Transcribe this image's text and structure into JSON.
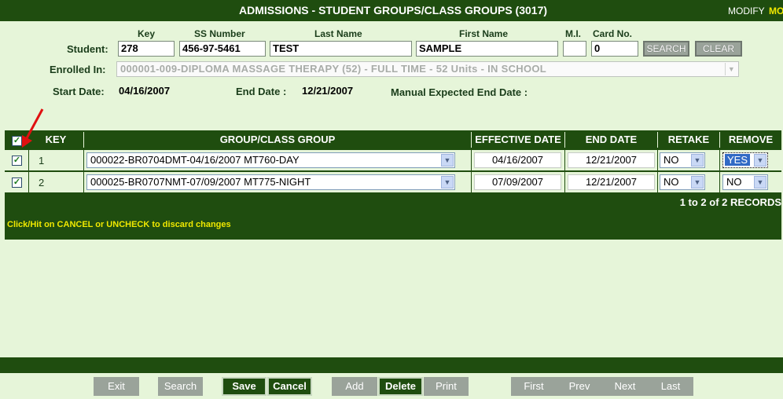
{
  "header": {
    "title": "ADMISSIONS - STUDENT GROUPS/CLASS GROUPS (3017)",
    "mode": "MODIFY",
    "mode_short": "MO"
  },
  "student": {
    "label": "Student:",
    "key_header": "Key",
    "ssn_header": "SS Number",
    "last_header": "Last Name",
    "first_header": "First Name",
    "mi_header": "M.I.",
    "card_header": "Card No.",
    "key": "278",
    "ssn": "456-97-5461",
    "last_name": "TEST",
    "first_name": "SAMPLE",
    "mi": "",
    "card_no": "0",
    "search_label": "SEARCH",
    "clear_label": "CLEAR"
  },
  "enrollment": {
    "label": "Enrolled In:",
    "value": "000001-009-DIPLOMA MASSAGE THERAPY (52) - FULL TIME - 52 Units - IN SCHOOL",
    "start_label": "Start Date:",
    "start_date": "04/16/2007",
    "end_label": "End Date :",
    "end_date": "12/21/2007",
    "manual_label": "Manual Expected End Date :"
  },
  "grid": {
    "columns": {
      "key": "KEY",
      "group": "GROUP/CLASS GROUP",
      "effective": "EFFECTIVE DATE",
      "end": "END DATE",
      "retake": "RETAKE",
      "remove": "REMOVE"
    },
    "rows": [
      {
        "checked": "✓",
        "key": "1",
        "group": "000022-BR0704DMT-04/16/2007 MT760-DAY",
        "effective": "04/16/2007",
        "end": "12/21/2007",
        "retake": "NO",
        "remove": "YES"
      },
      {
        "checked": "✓",
        "key": "2",
        "group": "000025-BR0707NMT-07/09/2007 MT775-NIGHT",
        "effective": "07/09/2007",
        "end": "12/21/2007",
        "retake": "NO",
        "remove": "NO"
      }
    ],
    "header_check": "✓",
    "records": "1 to 2 of 2 RECORDS",
    "hint": "Click/Hit on CANCEL or UNCHECK to discard changes"
  },
  "toolbar": {
    "exit": "Exit",
    "search": "Search",
    "save": "Save",
    "cancel": "Cancel",
    "add": "Add",
    "delete": "Delete",
    "print": "Print",
    "first": "First",
    "prev": "Prev",
    "next": "Next",
    "last": "Last"
  },
  "colors": {
    "bar": "#1f4d0f",
    "background": "#e6f5d9",
    "hint": "#f0e800",
    "arrow": "#e01010"
  }
}
